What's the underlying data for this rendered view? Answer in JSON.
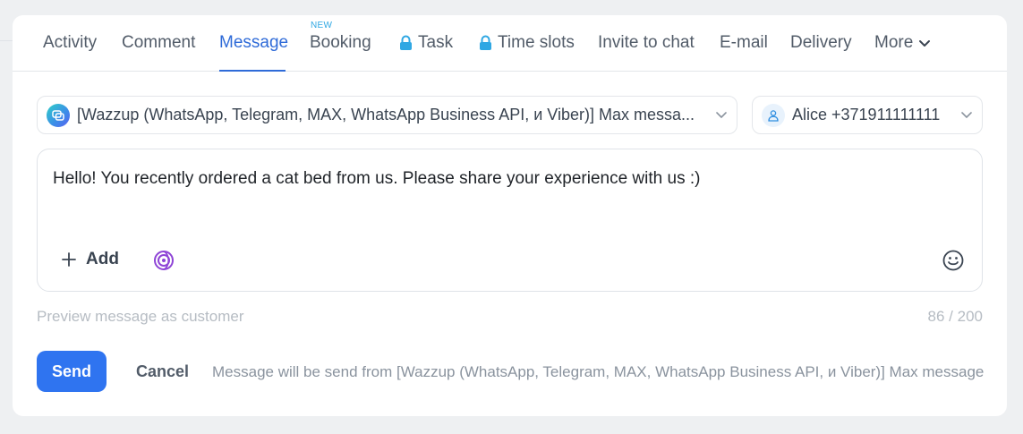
{
  "tabs": [
    {
      "label": "Activity",
      "active": false,
      "locked": false
    },
    {
      "label": "Comment",
      "active": false,
      "locked": false
    },
    {
      "label": "Message",
      "active": true,
      "locked": false
    },
    {
      "label": "Booking",
      "active": false,
      "locked": false,
      "badge": "NEW"
    },
    {
      "label": "Task",
      "active": false,
      "locked": true
    },
    {
      "label": "Time slots",
      "active": false,
      "locked": true
    },
    {
      "label": "Invite to chat",
      "active": false,
      "locked": false
    },
    {
      "label": "E-mail",
      "active": false,
      "locked": false
    },
    {
      "label": "Delivery",
      "active": false,
      "locked": false
    },
    {
      "label": "More",
      "active": false,
      "locked": false
    }
  ],
  "channel_select": {
    "value": "[Wazzup (WhatsApp, Telegram, MAX, WhatsApp Business API, и Viber)] Max messa...",
    "icon": "wazzup-chat-icon"
  },
  "contact_select": {
    "value": "Alice +371911111111",
    "icon": "user-icon"
  },
  "message": {
    "text": "Hello! You recently ordered a cat bed from us. Please share your experience with us :)",
    "add_label": "Add"
  },
  "preview_label": "Preview message as customer",
  "counter": "86 / 200",
  "actions": {
    "send_label": "Send",
    "cancel_label": "Cancel",
    "send_from": "Message will be send from [Wazzup (WhatsApp, Telegram, MAX, WhatsApp Business API, и Viber)] Max message"
  },
  "colors": {
    "accent": "#2f6bd8",
    "send_button": "#2f74f0",
    "badge": "#2fa7e3",
    "copilot": "#8e44d6"
  }
}
